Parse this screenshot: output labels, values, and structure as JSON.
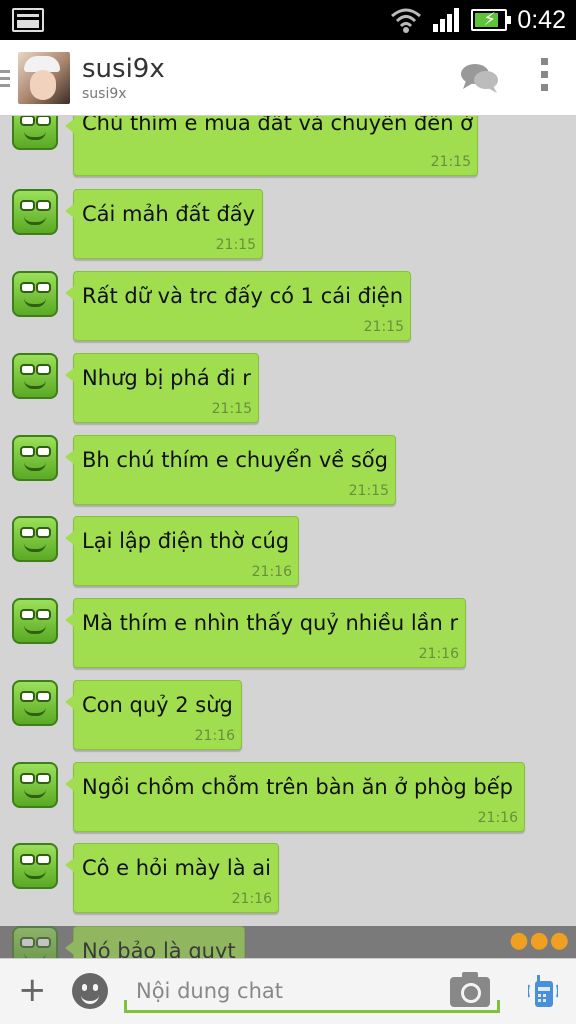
{
  "status_bar": {
    "time": "0:42"
  },
  "header": {
    "title": "susi9x",
    "subtitle": "susi9x"
  },
  "messages": [
    {
      "text": "Chú thím e mua đất và chuyển đến ở",
      "time": "21:15"
    },
    {
      "text": "Cái mảh đất đấy",
      "time": "21:15"
    },
    {
      "text": "Rất dữ và trc đấy có 1 cái điện",
      "time": "21:15"
    },
    {
      "text": "Nhưg bị phá đi r",
      "time": "21:15"
    },
    {
      "text": "Bh chú thím e chuyển về sốg",
      "time": "21:15"
    },
    {
      "text": "Lại lập điện thờ cúg",
      "time": "21:16"
    },
    {
      "text": "Mà thím e nhìn thấy quỷ nhiều lần r",
      "time": "21:16"
    },
    {
      "text": "Con quỷ 2 sừg",
      "time": "21:16"
    },
    {
      "text": "Ngồi chồm chỗm trên bàn ăn ở phòg bếp",
      "time": "21:16"
    },
    {
      "text": "Cô e hỏi mày là ai",
      "time": "21:16"
    },
    {
      "text": "Nó bảo là quyt",
      "time": ""
    }
  ],
  "input": {
    "placeholder": "Nội dung chat"
  },
  "colors": {
    "bubble": "#a0de50",
    "accent": "#7cc23d",
    "background": "#d4d4d4"
  }
}
